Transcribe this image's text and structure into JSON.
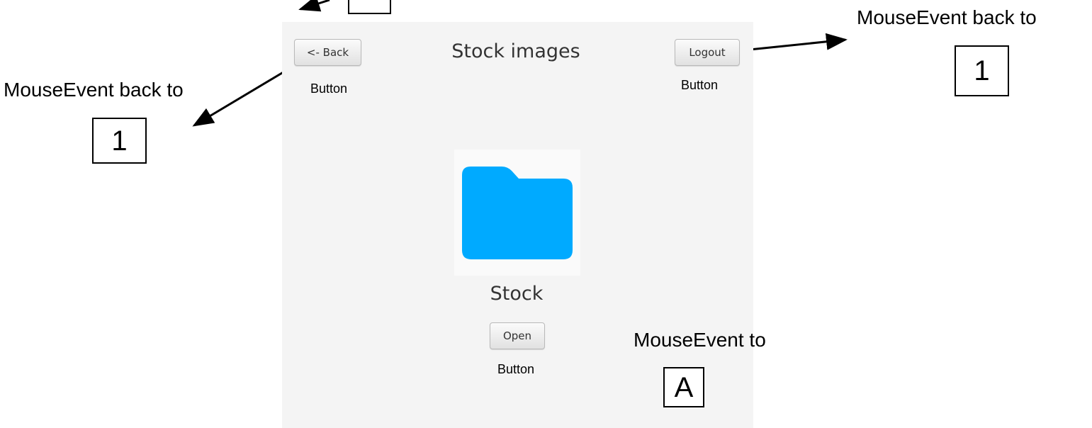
{
  "screen": {
    "title": "Stock images",
    "back_button": "<- Back",
    "logout_button": "Logout",
    "folder_label": "Stock",
    "open_button": "Open"
  },
  "annotations": {
    "back_button_type": "Button",
    "logout_button_type": "Button",
    "open_button_type": "Button",
    "back_event": "MouseEvent back to",
    "back_target": "1",
    "logout_event": "MouseEvent back to",
    "logout_target": "1",
    "open_event": "MouseEvent to",
    "open_target": "A"
  },
  "colors": {
    "folder": "#00aaff",
    "panel": "#f4f4f4"
  }
}
